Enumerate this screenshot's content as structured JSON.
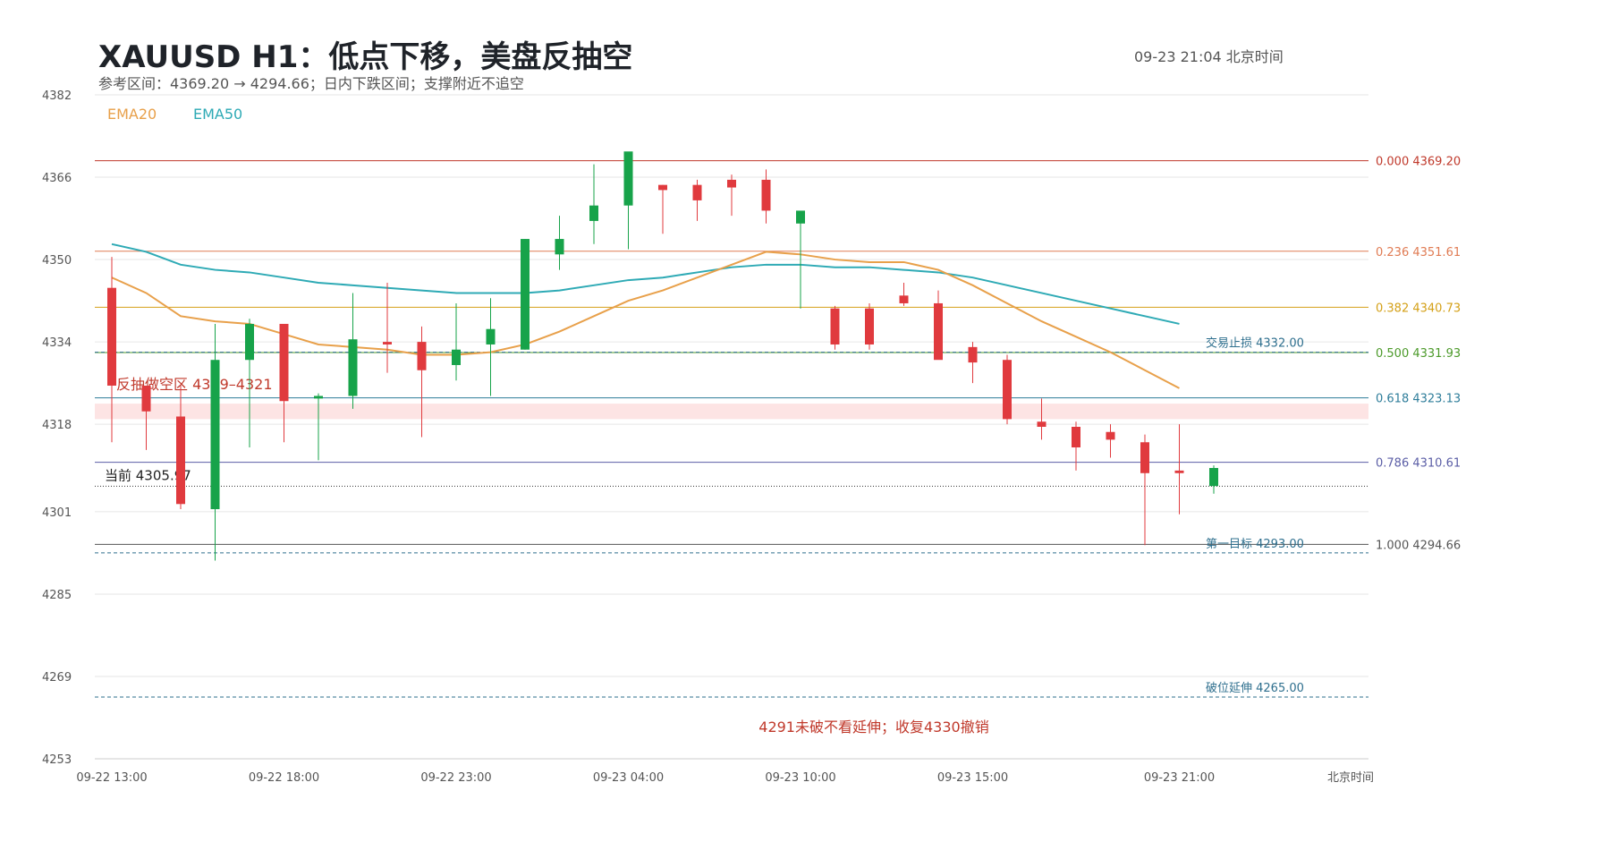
{
  "header": {
    "title": "XAUUSD  H1：低点下移，美盘反抽空",
    "subtitle": "参考区间：4369.20 → 4294.66；日内下跌区间；支撑附近不追空",
    "timestamp": "09-23  21:04 北京时间"
  },
  "chart_data": {
    "type": "candlestick",
    "title": "XAUUSD  H1：低点下移，美盘反抽空",
    "subtitle": "参考区间：4369.20 → 4294.66；日内下跌区间；支撑附近不追空",
    "ylim": [
      4253,
      4382
    ],
    "y_ticks": [
      4382,
      4366,
      4350,
      4334,
      4318,
      4301,
      4285,
      4269,
      4253
    ],
    "x_ticks": [
      {
        "label": "09-22 13:00",
        "index": 0
      },
      {
        "label": "09-22 18:00",
        "index": 5
      },
      {
        "label": "09-22 23:00",
        "index": 10
      },
      {
        "label": "09-23 04:00",
        "index": 15
      },
      {
        "label": "09-23 10:00",
        "index": 20
      },
      {
        "label": "09-23 15:00",
        "index": 25
      },
      {
        "label": "09-23 21:00",
        "index": 31
      }
    ],
    "x_axis_unit": "北京时间",
    "legend": [
      {
        "name": "EMA20",
        "color": "#e8a04a"
      },
      {
        "name": "EMA50",
        "color": "#2eaab5"
      }
    ],
    "colors": {
      "up": "#17a34a",
      "down": "#e03a3e",
      "ema20": "#e8a04a",
      "ema50": "#2eaab5"
    },
    "candles": [
      {
        "o": 4344.5,
        "h": 4350.5,
        "l": 4314.5,
        "c": 4325.5
      },
      {
        "o": 4325.5,
        "h": 4325.5,
        "l": 4313.0,
        "c": 4320.5
      },
      {
        "o": 4319.5,
        "h": 4325.5,
        "l": 4301.5,
        "c": 4302.5
      },
      {
        "o": 4301.5,
        "h": 4337.5,
        "l": 4291.5,
        "c": 4330.5
      },
      {
        "o": 4330.5,
        "h": 4338.5,
        "l": 4313.5,
        "c": 4337.5
      },
      {
        "o": 4337.5,
        "h": 4337.5,
        "l": 4314.5,
        "c": 4322.5
      },
      {
        "o": 4323.0,
        "h": 4324.0,
        "l": 4311.0,
        "c": 4323.5
      },
      {
        "o": 4323.5,
        "h": 4343.5,
        "l": 4321.0,
        "c": 4334.5
      },
      {
        "o": 4334.0,
        "h": 4345.5,
        "l": 4328.0,
        "c": 4333.5
      },
      {
        "o": 4334.0,
        "h": 4337.0,
        "l": 4315.5,
        "c": 4328.5
      },
      {
        "o": 4329.5,
        "h": 4341.5,
        "l": 4326.5,
        "c": 4332.5
      },
      {
        "o": 4333.5,
        "h": 4342.5,
        "l": 4323.5,
        "c": 4336.5
      },
      {
        "o": 4332.5,
        "h": 4354.0,
        "l": 4332.5,
        "c": 4354.0
      },
      {
        "o": 4351.0,
        "h": 4358.5,
        "l": 4348.0,
        "c": 4354.0
      },
      {
        "o": 4357.5,
        "h": 4368.5,
        "l": 4353.0,
        "c": 4360.5
      },
      {
        "o": 4360.5,
        "h": 4369.2,
        "l": 4352.0,
        "c": 4371.0
      },
      {
        "o": 4364.5,
        "h": 4364.5,
        "l": 4355.0,
        "c": 4363.5
      },
      {
        "o": 4364.5,
        "h": 4365.5,
        "l": 4357.5,
        "c": 4361.5
      },
      {
        "o": 4365.5,
        "h": 4366.5,
        "l": 4358.5,
        "c": 4364.0
      },
      {
        "o": 4365.5,
        "h": 4367.5,
        "l": 4357.0,
        "c": 4359.5
      },
      {
        "o": 4357.0,
        "h": 4358.0,
        "l": 4340.5,
        "c": 4359.5
      },
      {
        "o": 4340.5,
        "h": 4341.0,
        "l": 4332.5,
        "c": 4333.5
      },
      {
        "o": 4340.5,
        "h": 4341.5,
        "l": 4332.5,
        "c": 4333.5
      },
      {
        "o": 4343.0,
        "h": 4345.5,
        "l": 4341.0,
        "c": 4341.5
      },
      {
        "o": 4341.5,
        "h": 4344.0,
        "l": 4331.0,
        "c": 4330.5
      },
      {
        "o": 4333.0,
        "h": 4334.0,
        "l": 4326.0,
        "c": 4330.0
      },
      {
        "o": 4330.5,
        "h": 4331.5,
        "l": 4318.0,
        "c": 4319.0
      },
      {
        "o": 4318.5,
        "h": 4323.0,
        "l": 4315.0,
        "c": 4317.5
      },
      {
        "o": 4317.5,
        "h": 4318.5,
        "l": 4309.0,
        "c": 4313.5
      },
      {
        "o": 4316.5,
        "h": 4318.0,
        "l": 4311.5,
        "c": 4315.0
      },
      {
        "o": 4314.5,
        "h": 4316.0,
        "l": 4294.5,
        "c": 4308.5
      },
      {
        "o": 4309.0,
        "h": 4318.0,
        "l": 4300.5,
        "c": 4308.5
      },
      {
        "o": 4306.0,
        "h": 4310.0,
        "l": 4304.5,
        "c": 4309.5
      }
    ],
    "ema20": [
      4346.5,
      4343.5,
      4339.0,
      4338.0,
      4337.5,
      4335.5,
      4333.5,
      4333.0,
      4332.5,
      4331.5,
      4331.5,
      4332.0,
      4333.5,
      4336.0,
      4339.0,
      4342.0,
      4344.0,
      4346.5,
      4349.0,
      4351.5,
      4351.0,
      4350.0,
      4349.5,
      4349.5,
      4348.0,
      4345.0,
      4341.5,
      4338.0,
      4335.0,
      4332.0,
      4328.5,
      4325.0
    ],
    "ema50": [
      4353.0,
      4351.5,
      4349.0,
      4348.0,
      4347.5,
      4346.5,
      4345.5,
      4345.0,
      4344.5,
      4344.0,
      4343.5,
      4343.5,
      4343.5,
      4344.0,
      4345.0,
      4346.0,
      4346.5,
      4347.5,
      4348.5,
      4349.0,
      4349.0,
      4348.5,
      4348.5,
      4348.0,
      4347.5,
      4346.5,
      4345.0,
      4343.5,
      4342.0,
      4340.5,
      4339.0,
      4337.5
    ],
    "fib_levels": [
      {
        "ratio": "0.000",
        "price": "4369.20",
        "color": "#c0392b"
      },
      {
        "ratio": "0.236",
        "price": "4351.61",
        "color": "#e07b53"
      },
      {
        "ratio": "0.382",
        "price": "4340.73",
        "color": "#d4a017"
      },
      {
        "ratio": "0.500",
        "price": "4331.93",
        "color": "#4c9a2a"
      },
      {
        "ratio": "0.618",
        "price": "4323.13",
        "color": "#2e7d9a"
      },
      {
        "ratio": "0.786",
        "price": "4310.61",
        "color": "#5b5ea6"
      },
      {
        "ratio": "1.000",
        "price": "4294.66",
        "color": "#555555"
      }
    ],
    "levels": [
      {
        "label": "交易止损 4332.00",
        "price": 4332.0,
        "color": "#2e6f8e"
      },
      {
        "label": "第一目标 4293.00",
        "price": 4293.0,
        "color": "#2e6f8e"
      },
      {
        "label": "破位延伸 4265.00",
        "price": 4265.0,
        "color": "#2e6f8e"
      }
    ],
    "zone": {
      "label": "反抽做空区  4319–4321",
      "low": 4319,
      "high": 4321,
      "color": "#fde4e4"
    },
    "current": {
      "label": "当前 4305.97",
      "price": 4305.97
    },
    "note": "4291未破不看延伸；收复4330撤销"
  }
}
